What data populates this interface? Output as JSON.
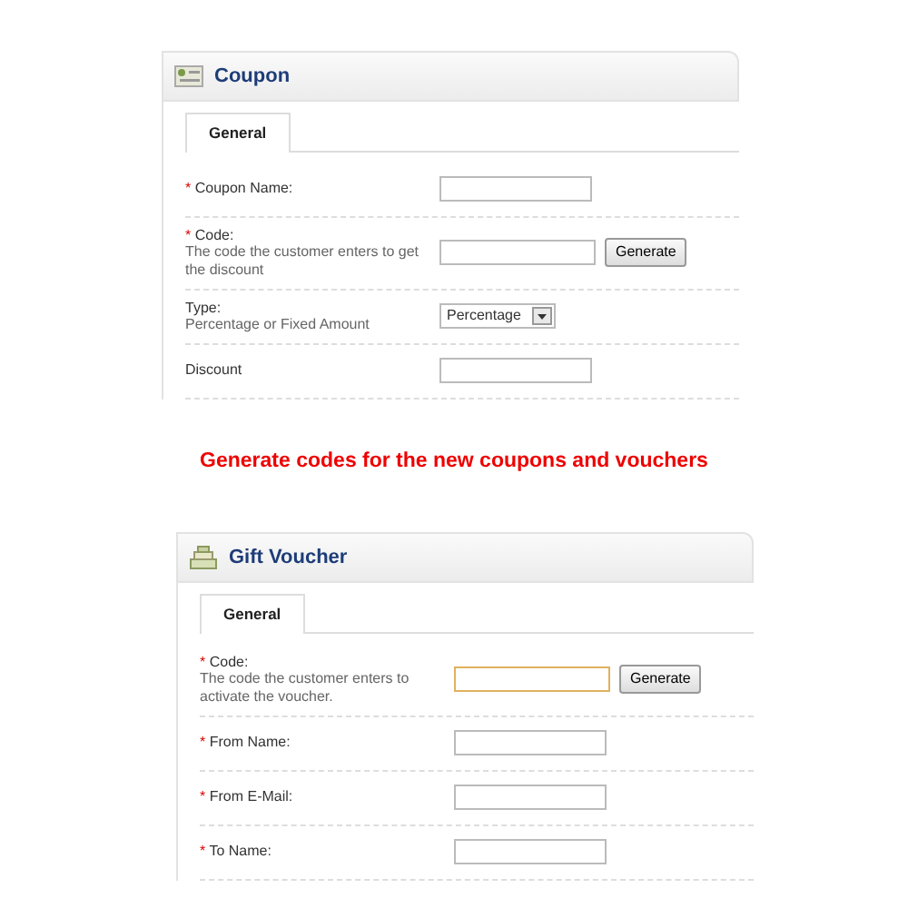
{
  "panels": [
    {
      "title": "Coupon",
      "tabs": [
        {
          "label": "General",
          "selected": true
        }
      ],
      "rows": [
        {
          "kind": "text",
          "marker": "*",
          "label": "Coupon Name:",
          "focused": false
        },
        {
          "kind": "generate",
          "marker": "*",
          "label": "Code:",
          "hint": "The code the customer enters to get the discount",
          "button": "Generate",
          "focused": false
        },
        {
          "kind": "select",
          "label": "Type:",
          "hint": "Percentage or Fixed Amount",
          "value": "Percentage"
        },
        {
          "kind": "text",
          "label": "Discount",
          "focused": false
        }
      ]
    },
    {
      "caption": "Generate codes for the new coupons and vouchers"
    },
    {
      "title": "Gift Voucher",
      "tabs": [
        {
          "label": "General",
          "selected": true
        }
      ],
      "rows": [
        {
          "kind": "generate",
          "marker": "*",
          "label": "Code:",
          "hint": "The code the customer enters to activate the voucher.",
          "button": "Generate",
          "focused": true
        },
        {
          "kind": "text",
          "marker": "*",
          "label": "From Name:",
          "focused": false
        },
        {
          "kind": "text",
          "marker": "*",
          "label": "From E-Mail:",
          "focused": false
        },
        {
          "kind": "text",
          "marker": "*",
          "label": "To Name:",
          "focused": false
        }
      ]
    }
  ]
}
